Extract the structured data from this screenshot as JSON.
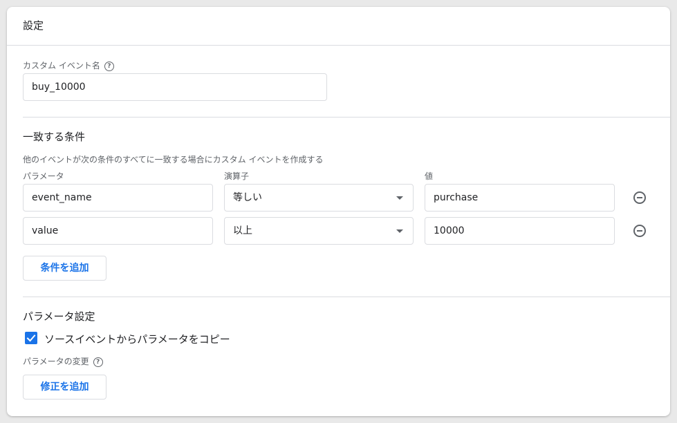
{
  "settings": {
    "title": "設定",
    "custom_event_name_label": "カスタム イベント名",
    "custom_event_name_value": "buy_10000",
    "matching_conditions_title": "一致する条件",
    "matching_conditions_desc": "他のイベントが次の条件のすべてに一致する場合にカスタム イベントを作成する",
    "columns": {
      "parameter": "パラメータ",
      "operator": "演算子",
      "value": "値"
    },
    "conditions": [
      {
        "parameter": "event_name",
        "operator": "等しい",
        "value": "purchase"
      },
      {
        "parameter": "value",
        "operator": "以上",
        "value": "10000"
      }
    ],
    "add_condition_button": "条件を追加",
    "parameter_settings_title": "パラメータ設定",
    "copy_parameters_label": "ソースイベントからパラメータをコピー",
    "copy_parameters_checked": true,
    "parameter_changes_label": "パラメータの変更",
    "add_modification_button": "修正を追加"
  },
  "icons": {
    "help": "help-circle-icon",
    "remove": "remove-circle-icon",
    "dropdown": "chevron-down-icon",
    "check": "check-icon"
  },
  "colors": {
    "accent": "#1a73e8",
    "border": "#dadce0",
    "muted_text": "#5f6368"
  }
}
